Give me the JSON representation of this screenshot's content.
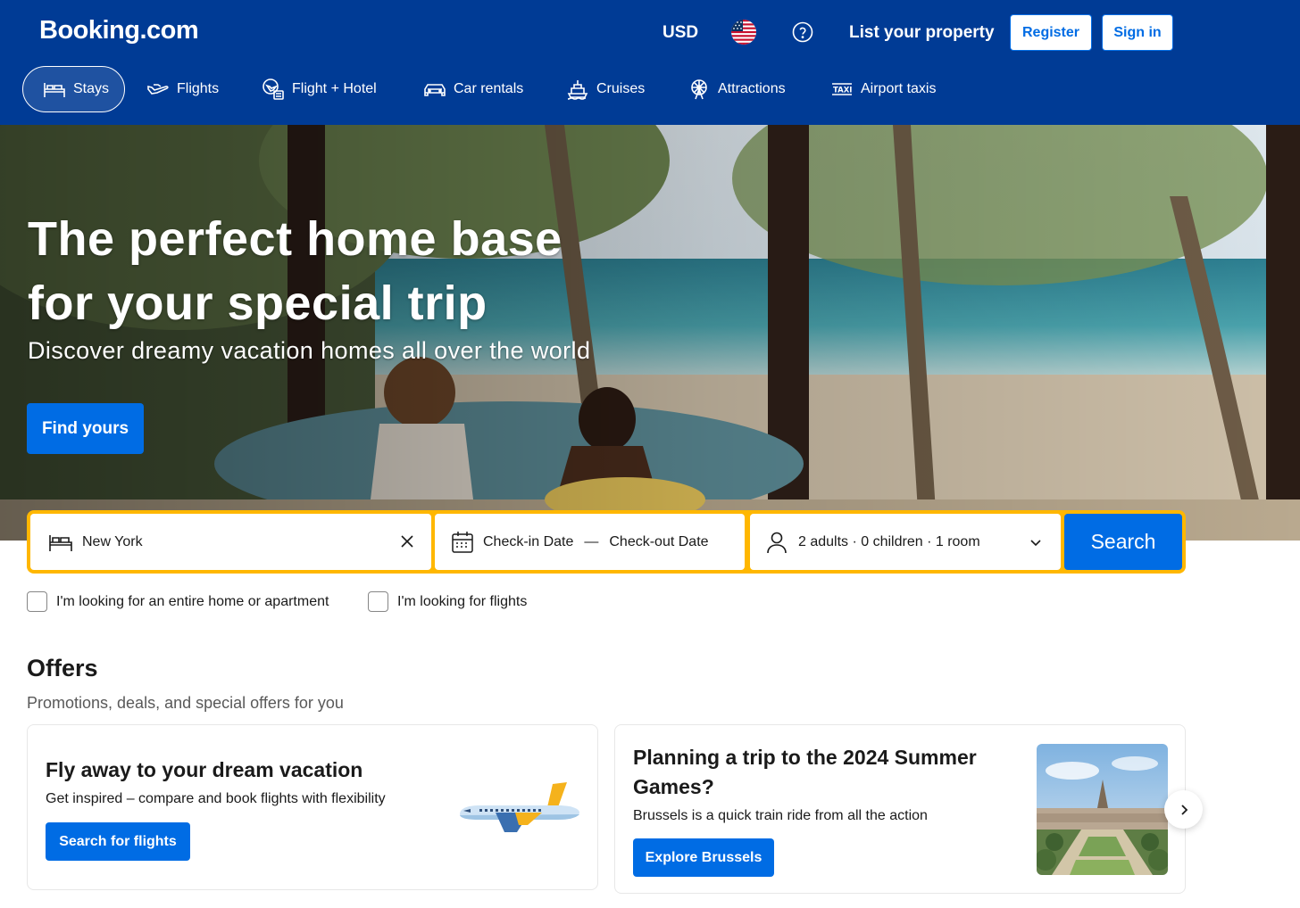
{
  "header": {
    "logo": "Booking.com",
    "currency": "USD",
    "list_property": "List your property",
    "register": "Register",
    "sign_in": "Sign in"
  },
  "nav": {
    "items": [
      {
        "label": "Stays",
        "icon": "bed-icon",
        "active": true
      },
      {
        "label": "Flights",
        "icon": "plane-icon"
      },
      {
        "label": "Flight + Hotel",
        "icon": "flight-hotel-icon"
      },
      {
        "label": "Car rentals",
        "icon": "car-icon"
      },
      {
        "label": "Cruises",
        "icon": "ship-icon"
      },
      {
        "label": "Attractions",
        "icon": "ferris-wheel-icon"
      },
      {
        "label": "Airport taxis",
        "icon": "taxi-icon"
      }
    ]
  },
  "hero": {
    "title_line1": "The perfect home base",
    "title_line2": "for your special trip",
    "subtitle": "Discover dreamy vacation homes all over the world",
    "cta": "Find yours"
  },
  "search": {
    "destination_value": "New York",
    "checkin": "Check-in Date",
    "dash": "—",
    "checkout": "Check-out Date",
    "guests": "2 adults · 0 children · 1 room",
    "button": "Search"
  },
  "checkboxes": {
    "entire_home": "I'm looking for an entire home or apartment",
    "flights": "I'm looking for flights"
  },
  "offers": {
    "title": "Offers",
    "subtitle": "Promotions, deals, and special offers for you",
    "cards": [
      {
        "title": "Fly away to your dream vacation",
        "text": "Get inspired – compare and book flights with flexibility",
        "button": "Search for flights"
      },
      {
        "title_line1": "Planning a trip to the 2024 Summer",
        "title_line2": "Games?",
        "text": "Brussels is a quick train ride from all the action",
        "button": "Explore Brussels"
      }
    ]
  },
  "colors": {
    "brand_blue": "#003b95",
    "action_blue": "#006ce4",
    "search_yellow": "#ffb700"
  }
}
